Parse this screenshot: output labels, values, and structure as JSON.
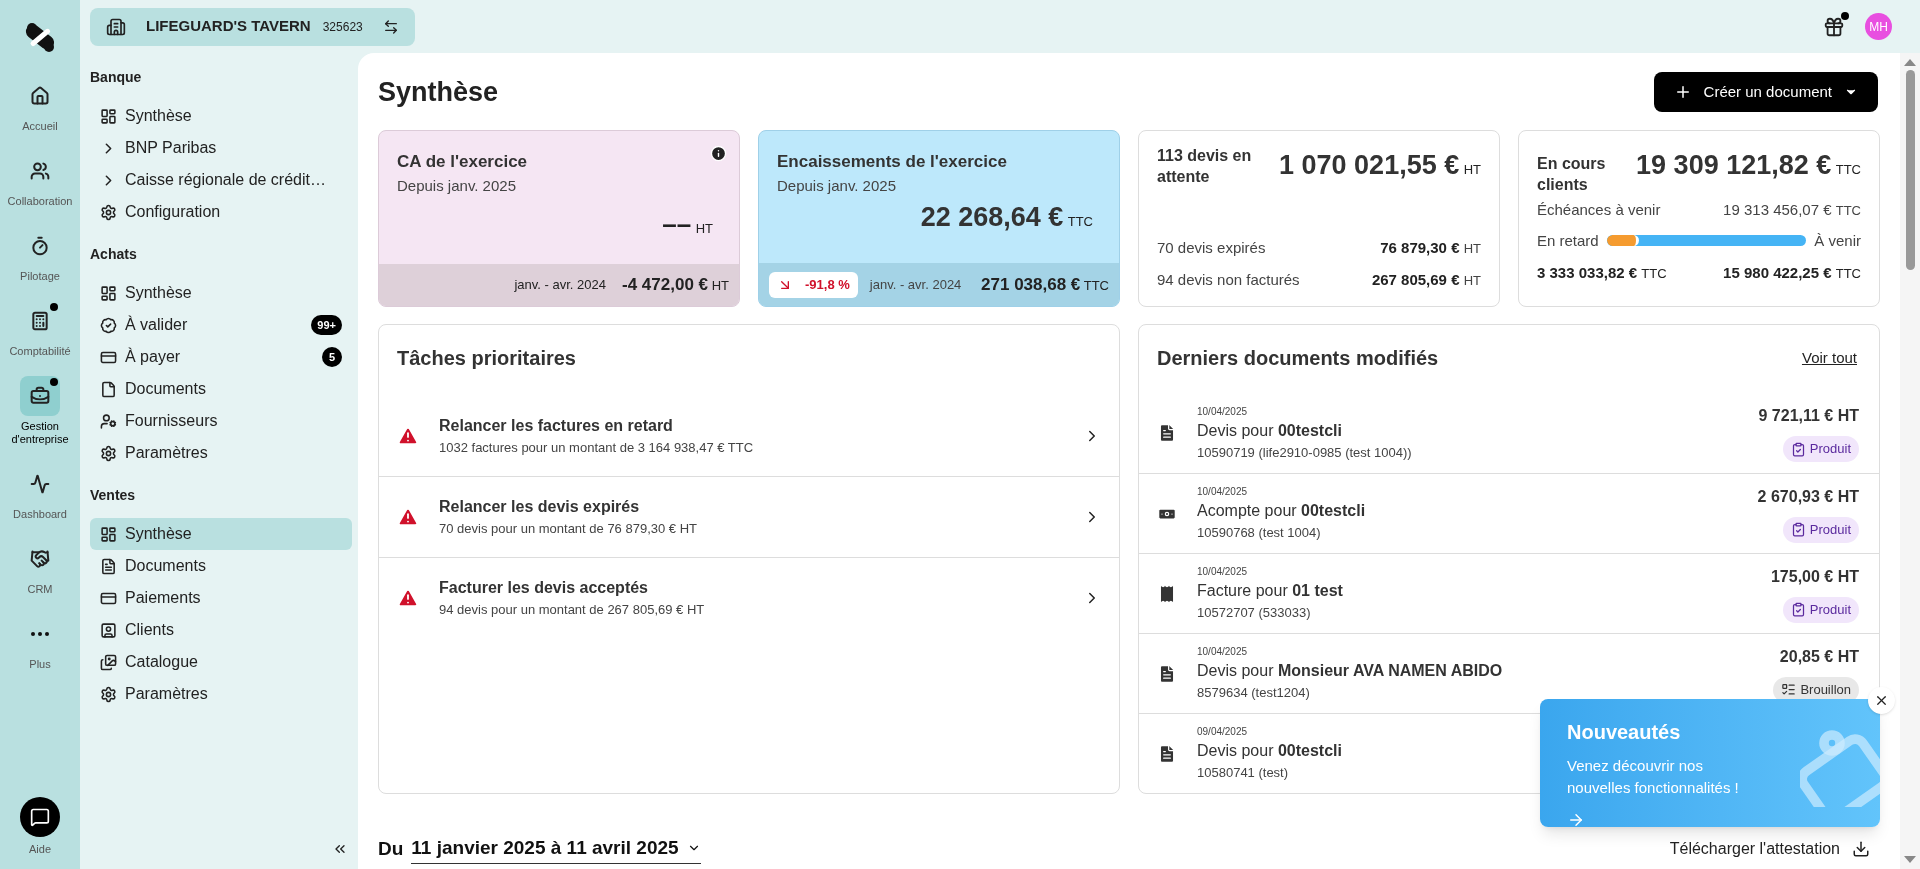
{
  "company": {
    "name": "LIFEGUARD'S TAVERN",
    "number": "325623"
  },
  "avatar": {
    "initials": "MH"
  },
  "rail": [
    {
      "label": "Accueil",
      "selected": false,
      "dot": false
    },
    {
      "label": "Collaboration",
      "selected": false,
      "dot": false
    },
    {
      "label": "Pilotage",
      "selected": false,
      "dot": false
    },
    {
      "label": "Comptabilité",
      "selected": false,
      "dot": true
    },
    {
      "label": "Gestion d'entreprise",
      "selected": true,
      "dot": true
    },
    {
      "label": "Dashboard",
      "selected": false,
      "dot": false
    },
    {
      "label": "CRM",
      "selected": false,
      "dot": false
    },
    {
      "label": "Plus",
      "selected": false,
      "dot": false
    }
  ],
  "help": {
    "label": "Aide"
  },
  "sidebar": [
    {
      "title": "Banque",
      "items": [
        {
          "label": "Synthèse",
          "selected": false
        },
        {
          "label": "BNP Paribas",
          "selected": false,
          "expanded": false
        },
        {
          "label": "Caisse régionale de crédit…",
          "selected": false,
          "expanded": false
        },
        {
          "label": "Configuration",
          "selected": false
        }
      ]
    },
    {
      "title": "Achats",
      "items": [
        {
          "label": "Synthèse",
          "selected": false
        },
        {
          "label": "À valider",
          "selected": false,
          "badge": "99+"
        },
        {
          "label": "À payer",
          "selected": false,
          "badge": "5"
        },
        {
          "label": "Documents",
          "selected": false
        },
        {
          "label": "Fournisseurs",
          "selected": false
        },
        {
          "label": "Paramètres",
          "selected": false
        }
      ]
    },
    {
      "title": "Ventes",
      "items": [
        {
          "label": "Synthèse",
          "selected": true
        },
        {
          "label": "Documents",
          "selected": false
        },
        {
          "label": "Paiements",
          "selected": false
        },
        {
          "label": "Clients",
          "selected": false
        },
        {
          "label": "Catalogue",
          "selected": false
        },
        {
          "label": "Paramètres",
          "selected": false
        }
      ]
    }
  ],
  "page": {
    "title": "Synthèse",
    "create_button": "Créer un document"
  },
  "ca_card": {
    "title": "CA de l'exercice",
    "subtitle": "Depuis janv. 2025",
    "value": "––",
    "unit": "HT",
    "period": "janv. - avr. 2024",
    "previous": "-4 472,00 €",
    "previous_unit": "HT"
  },
  "cash_card": {
    "title": "Encaissements de l'exercice",
    "subtitle": "Depuis janv. 2025",
    "value": "22 268,64 €",
    "unit": "TTC",
    "trend": "-91,8 %",
    "period": "janv. - avr. 2024",
    "previous": "271 038,68 €",
    "previous_unit": "TTC"
  },
  "quotes_card": {
    "title": "113 devis en attente",
    "value": "1 070 021,55 €",
    "unit": "HT",
    "rows": [
      {
        "label": "70 devis expirés",
        "value": "76 879,30 €",
        "unit": "HT"
      },
      {
        "label": "94 devis non facturés",
        "value": "267 805,69 €",
        "unit": "HT"
      }
    ]
  },
  "clients_card": {
    "title": "En cours clients",
    "value": "19 309 121,82 €",
    "unit": "TTC",
    "upcoming_label": "Échéances à venir",
    "upcoming_value": "19 313 456,07 €",
    "upcoming_unit": "TTC",
    "late_label": "En retard",
    "future_label": "À venir",
    "level": 0.16,
    "late_value": "3 333 033,82 €",
    "late_unit": "TTC",
    "future_value": "15 980 422,25 €",
    "future_unit": "TTC"
  },
  "tasks": {
    "title": "Tâches prioritaires",
    "items": [
      {
        "title": "Relancer les factures en retard",
        "detail": "1032 factures pour un montant de 3 164 938,47 € TTC"
      },
      {
        "title": "Relancer les devis expirés",
        "detail": "70 devis pour un montant de 76 879,30 € HT"
      },
      {
        "title": "Facturer les devis acceptés",
        "detail": "94 devis pour un montant de 267 805,69 € HT"
      }
    ]
  },
  "documents": {
    "title": "Derniers documents modifiés",
    "link": "Voir tout",
    "items": [
      {
        "kind": "quote",
        "date": "10/04/2025",
        "title": "Devis pour **00testcli**",
        "ref": "10590719 (life2910-0985 (test 1004))",
        "amount": "9 721,11 € HT",
        "status": {
          "kind": "produit",
          "label": "Produit"
        }
      },
      {
        "kind": "deposit",
        "date": "10/04/2025",
        "title": "Acompte pour **00testcli**",
        "ref": "10590768 (test 1004)",
        "amount": "2 670,93 € HT",
        "status": {
          "kind": "produit",
          "label": "Produit"
        }
      },
      {
        "kind": "invoice",
        "date": "10/04/2025",
        "title": "Facture pour **01 test**",
        "ref": "10572707 (533033)",
        "amount": "175,00 € HT",
        "status": {
          "kind": "produit",
          "label": "Produit"
        }
      },
      {
        "kind": "quote",
        "date": "10/04/2025",
        "title": "Devis pour **Monsieur AVA NAMEN ABIDO**",
        "ref": "8579634 (test1204)",
        "amount": "20,85 € HT",
        "status": {
          "kind": "brouillon",
          "label": "Brouillon"
        }
      },
      {
        "kind": "quote",
        "date": "09/04/2025",
        "title": "Devis pour **00testcli**",
        "ref": "10580741 (test)"
      }
    ]
  },
  "period": {
    "prefix": "Du",
    "range": "11 janvier 2025 à 11 avril 2025"
  },
  "download": {
    "label": "Télécharger l'attestation"
  },
  "news": {
    "title": "Nouveautés",
    "text": "Venez découvrir nos nouvelles fonctionnalités !"
  }
}
